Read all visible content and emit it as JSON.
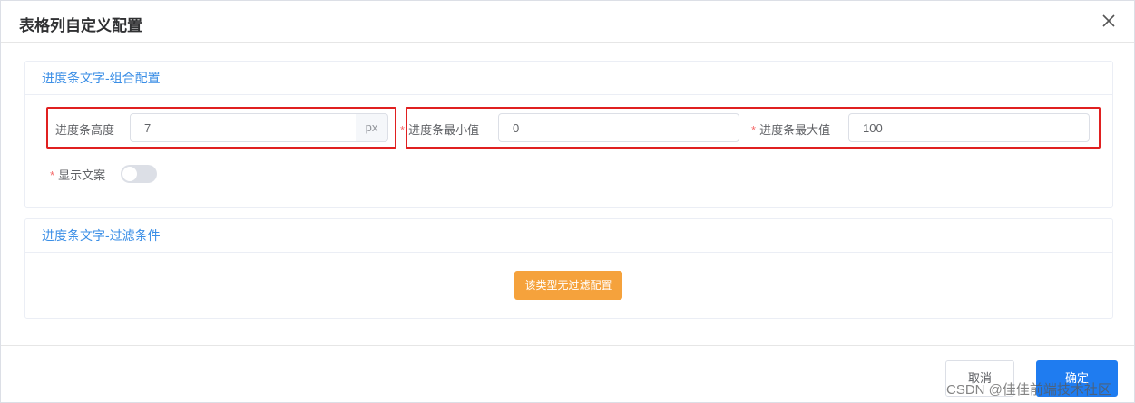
{
  "dialog": {
    "title": "表格列自定义配置",
    "close_icon": "close-icon"
  },
  "section_progress_text": {
    "title": "进度条文字-组合配置",
    "height_label": "进度条高度",
    "height_value": "7",
    "height_unit": "px",
    "min_label": "进度条最小值",
    "min_value": "0",
    "max_label": "进度条最大值",
    "max_value": "100",
    "required_mark": "*",
    "show_text_label": "显示文案",
    "show_text_enabled": false
  },
  "section_filter": {
    "title": "进度条文字-过滤条件",
    "notice": "该类型无过滤配置"
  },
  "footer": {
    "cancel_label": "取消",
    "ok_label": "确定"
  },
  "watermark": "CSDN @佳佳前端技术社区",
  "colors": {
    "accent": "#3a8ee6",
    "primary_button": "#1f7cf0",
    "warning": "#f5a23c",
    "required": "#f56c6c",
    "highlight": "#e02020"
  }
}
